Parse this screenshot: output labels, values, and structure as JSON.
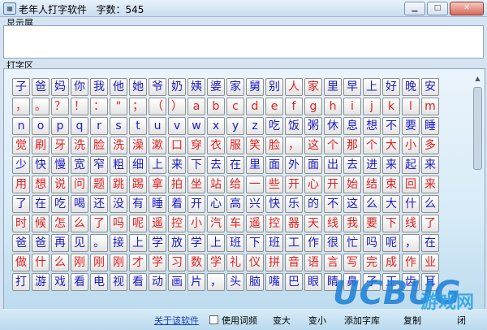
{
  "window": {
    "title": "老年人打字软件   字数：545",
    "buttons": {
      "minimize": "▁",
      "maximize": "□",
      "close": "✕"
    }
  },
  "display": {
    "label": "显示屏",
    "text": ""
  },
  "typing_area": {
    "label": "打字区",
    "keys": [
      [
        "子",
        "爸",
        "妈",
        "你",
        "我",
        "他",
        "她",
        "爷",
        "奶",
        "姨",
        "婆",
        "家",
        "舅",
        "别",
        "人",
        "家",
        "里",
        "早",
        "上",
        "好",
        "晚",
        "安"
      ],
      [
        "，",
        "。",
        "？",
        "！",
        "：",
        "\"",
        "；",
        "（",
        "）",
        "a",
        "b",
        "c",
        "d",
        "e",
        "f",
        "g",
        "h",
        "i",
        "j",
        "k",
        "l",
        "m"
      ],
      [
        "n",
        "o",
        "p",
        "q",
        "r",
        "s",
        "t",
        "u",
        "v",
        "w",
        "x",
        "y",
        "z",
        "吃",
        "饭",
        "粥",
        "休",
        "息",
        "想",
        "不",
        "要",
        "睡"
      ],
      [
        "觉",
        "刷",
        "牙",
        "洗",
        "脸",
        "洗",
        "澡",
        "漱",
        "口",
        "穿",
        "衣",
        "服",
        "笑",
        "脸",
        "，",
        "这",
        "个",
        "那",
        "个",
        "大",
        "小",
        "多"
      ],
      [
        "少",
        "快",
        "慢",
        "宽",
        "窄",
        "粗",
        "细",
        "上",
        "来",
        "下",
        "去",
        "在",
        "里",
        "面",
        "外",
        "面",
        "出",
        "去",
        "进",
        "来",
        "起",
        "来"
      ],
      [
        "用",
        "想",
        "说",
        "问",
        "题",
        "跳",
        "踢",
        "拿",
        "拍",
        "坐",
        "站",
        "给",
        "一",
        "些",
        "开",
        "心",
        "开",
        "始",
        "结",
        "束",
        "回",
        "来"
      ],
      [
        "了",
        "在",
        "吃",
        "喝",
        "还",
        "没",
        "有",
        "睡",
        "着",
        "开",
        "心",
        "高",
        "兴",
        "快",
        "乐",
        "的",
        "不",
        "这",
        "么",
        "大",
        "什",
        "么"
      ],
      [
        "时",
        "候",
        "怎",
        "么",
        "了",
        "吗",
        "呢",
        "遥",
        "控",
        "小",
        "汽",
        "车",
        "遥",
        "控",
        "器",
        "天",
        "线",
        "我",
        "要",
        "下",
        "线",
        "了"
      ],
      [
        "爸",
        "爸",
        "再",
        "见",
        "。",
        "接",
        "上",
        "学",
        "放",
        "学",
        "上",
        "班",
        "下",
        "班",
        "工",
        "作",
        "很",
        "忙",
        "吗",
        "呢",
        "，",
        "在"
      ],
      [
        "做",
        "什",
        "么",
        "刚",
        "刚",
        "刚",
        "才",
        "学",
        "习",
        "数",
        "学",
        "礼",
        "仪",
        "拼",
        "音",
        "语",
        "言",
        "写",
        "完",
        "成",
        "作",
        "业"
      ],
      [
        "打",
        "游",
        "戏",
        "看",
        "电",
        "视",
        "看",
        "动",
        "画",
        "片",
        "，",
        "头",
        "脑",
        "嘴",
        "巴",
        "眼",
        "睛",
        "鼻",
        "子",
        "正",
        "齿",
        "耳"
      ]
    ],
    "colors": [
      [
        "b",
        "b",
        "b",
        "b",
        "b",
        "b",
        "b",
        "b",
        "b",
        "b",
        "b",
        "b",
        "b",
        "b",
        "r",
        "r",
        "b",
        "b",
        "b",
        "b",
        "b",
        "b"
      ],
      [
        "r",
        "r",
        "r",
        "r",
        "r",
        "r",
        "r",
        "r",
        "r",
        "r",
        "r",
        "r",
        "r",
        "r",
        "r",
        "r",
        "r",
        "r",
        "r",
        "r",
        "r",
        "r"
      ],
      [
        "b",
        "b",
        "b",
        "b",
        "b",
        "b",
        "b",
        "b",
        "b",
        "b",
        "b",
        "b",
        "b",
        "b",
        "b",
        "b",
        "b",
        "b",
        "b",
        "b",
        "b",
        "b"
      ],
      [
        "r",
        "r",
        "r",
        "r",
        "r",
        "r",
        "r",
        "r",
        "r",
        "r",
        "r",
        "r",
        "r",
        "r",
        "r",
        "r",
        "r",
        "r",
        "r",
        "r",
        "r",
        "r"
      ],
      [
        "b",
        "b",
        "b",
        "b",
        "b",
        "b",
        "b",
        "b",
        "b",
        "b",
        "b",
        "b",
        "b",
        "b",
        "b",
        "b",
        "b",
        "b",
        "b",
        "b",
        "b",
        "b"
      ],
      [
        "r",
        "r",
        "r",
        "r",
        "r",
        "r",
        "r",
        "r",
        "r",
        "r",
        "r",
        "r",
        "r",
        "r",
        "r",
        "r",
        "r",
        "r",
        "r",
        "r",
        "r",
        "r"
      ],
      [
        "b",
        "b",
        "b",
        "b",
        "b",
        "b",
        "b",
        "b",
        "b",
        "b",
        "b",
        "b",
        "b",
        "b",
        "b",
        "b",
        "b",
        "b",
        "b",
        "b",
        "b",
        "b"
      ],
      [
        "r",
        "r",
        "r",
        "r",
        "r",
        "r",
        "r",
        "r",
        "r",
        "r",
        "r",
        "r",
        "r",
        "r",
        "r",
        "r",
        "r",
        "r",
        "r",
        "r",
        "r",
        "r"
      ],
      [
        "b",
        "b",
        "b",
        "b",
        "b",
        "b",
        "b",
        "b",
        "b",
        "b",
        "b",
        "b",
        "b",
        "b",
        "b",
        "b",
        "b",
        "b",
        "b",
        "b",
        "b",
        "b"
      ],
      [
        "r",
        "r",
        "r",
        "r",
        "r",
        "r",
        "r",
        "r",
        "r",
        "r",
        "r",
        "r",
        "r",
        "r",
        "r",
        "r",
        "r",
        "r",
        "r",
        "r",
        "r",
        "r"
      ],
      [
        "b",
        "b",
        "b",
        "b",
        "b",
        "b",
        "b",
        "b",
        "b",
        "b",
        "b",
        "b",
        "b",
        "b",
        "b",
        "b",
        "b",
        "b",
        "b",
        "b",
        "b",
        "b"
      ]
    ],
    "colors_hex": {
      "b": "#1b1bc4",
      "r": "#e02020"
    }
  },
  "bottom_bar": {
    "about": "关于该软件",
    "use_phrases": "使用词频",
    "bigger": "变大",
    "smaller": "变小",
    "add_dict": "添加字库",
    "copy": "复制",
    "close_fragment": "闭"
  },
  "watermark": {
    "brand": "UCBUG",
    "suffix": "游戏网"
  }
}
